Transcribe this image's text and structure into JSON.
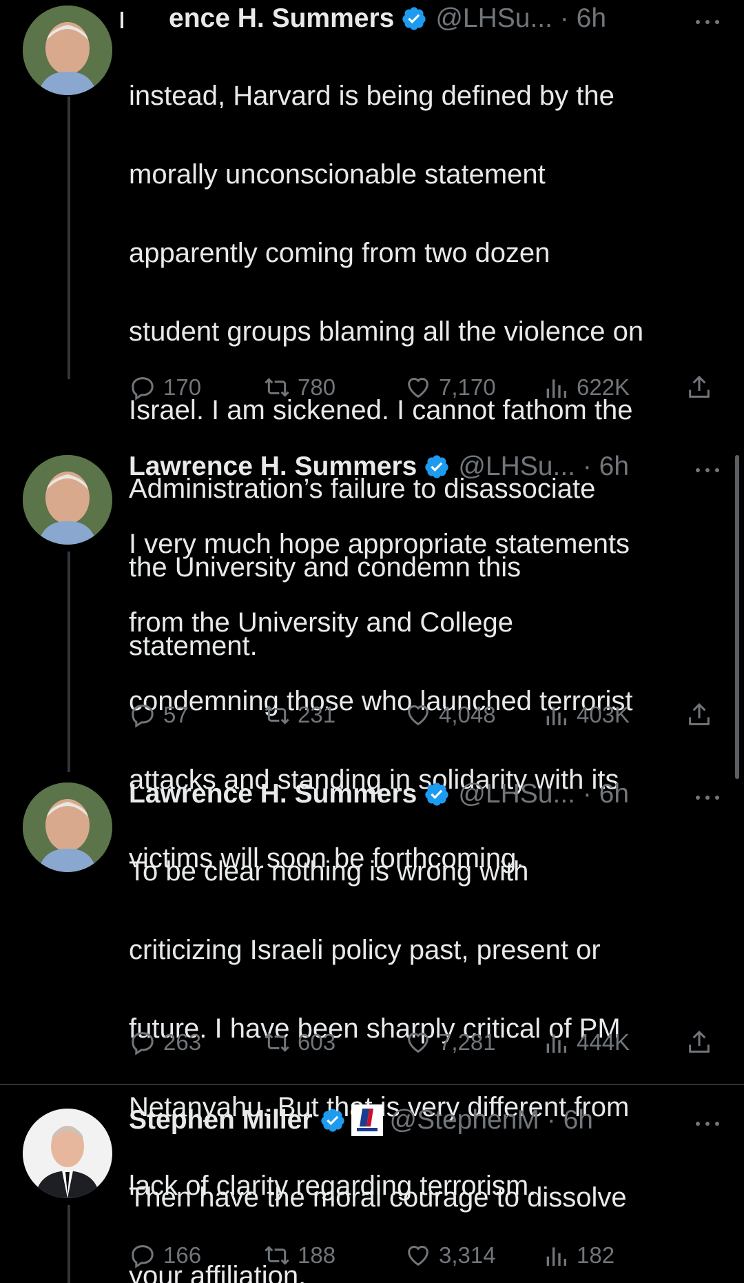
{
  "tweets": [
    {
      "name": "Lawrence H. Summers",
      "name_visible": "ence H. Summers",
      "handle": "@LHSu...",
      "time": "6h",
      "text": "instead, Harvard is being defined by the morally unconscionable statement apparently coming from two dozen student groups blaming all the violence on Israel. I am sickened. I cannot fathom the Administration’s failure to disassociate the University and condemn this statement.",
      "lines": [
        "instead, Harvard is being defined by the",
        "morally unconscionable statement",
        "apparently coming from two dozen",
        "student groups blaming all the violence on",
        "Israel. I am sickened. I cannot fathom the",
        "Administration’s failure to disassociate",
        "the University and condemn this",
        "statement."
      ],
      "replies": "170",
      "retweets": "780",
      "likes": "7,170",
      "views": "622K"
    },
    {
      "name": "Lawrence H. Summers",
      "handle": "@LHSu...",
      "time": "6h",
      "lines": [
        "I very much hope appropriate statements",
        "from the University and College",
        "condemning those who launched terrorist",
        "attacks and standing in solidarity with its",
        "victims will soon be forthcoming."
      ],
      "replies": "57",
      "retweets": "231",
      "likes": "4,048",
      "views": "403K"
    },
    {
      "name": "Lawrence H. Summers",
      "handle": "@LHSu...",
      "time": "6h",
      "lines": [
        "To be clear nothing is wrong with",
        "criticizing Israeli policy past, present or",
        "future.  I have been sharply critical of PM",
        "Netanyahu. But that is very different from",
        "lack of clarity regarding terrorism."
      ],
      "replies": "263",
      "retweets": "603",
      "likes": "7,281",
      "views": "444K"
    },
    {
      "name": "Stephen Miller",
      "handle": "@StephenM",
      "time": "6h",
      "lines": [
        "Then have the moral courage to dissolve",
        "your affiliation."
      ],
      "replies": "166",
      "retweets": "188",
      "likes": "3,314",
      "views": "182"
    }
  ],
  "colors": {
    "background": "#000000",
    "text": "#e7e9ea",
    "muted": "#71767b",
    "verified": "#1d9bf0",
    "divider": "#2f3336"
  },
  "icons": [
    "reply-icon",
    "retweet-icon",
    "like-icon",
    "views-icon",
    "share-icon",
    "verified-badge-icon",
    "more-icon"
  ]
}
